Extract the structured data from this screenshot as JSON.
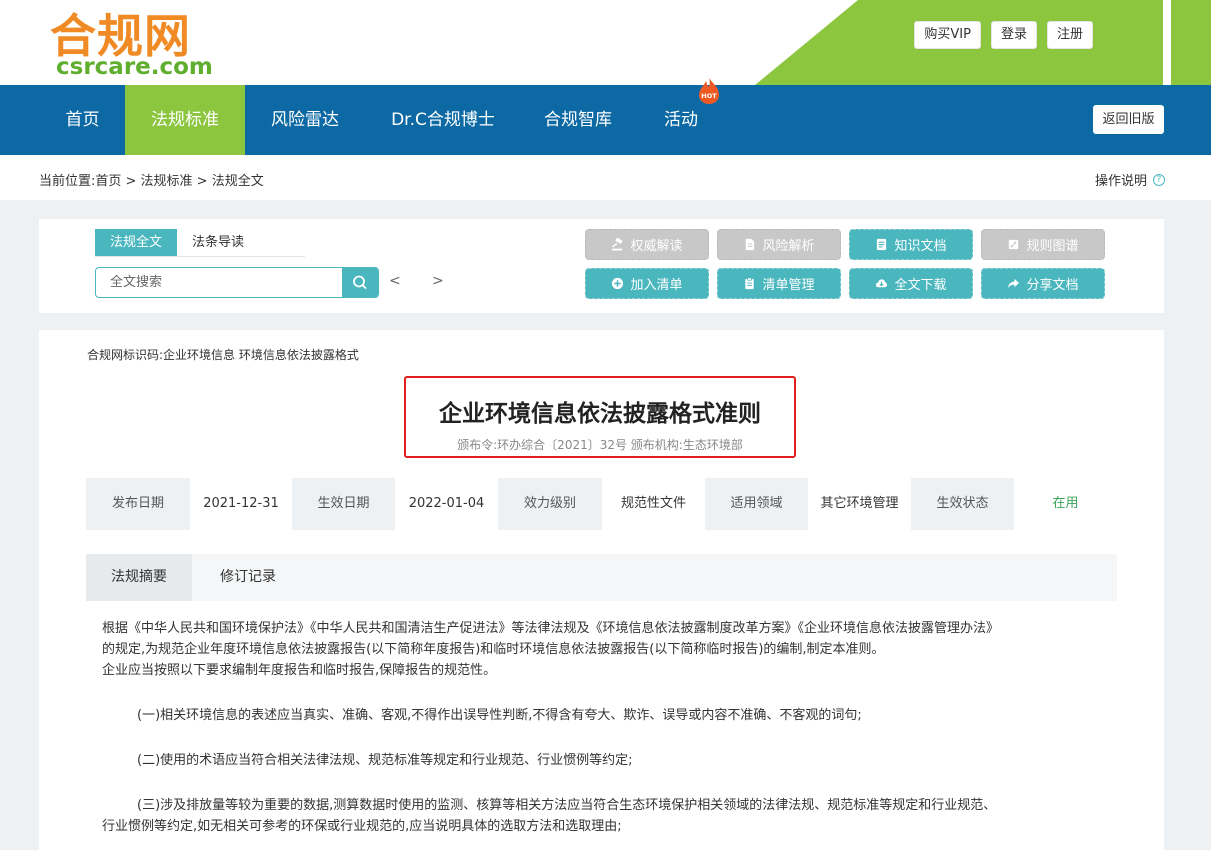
{
  "logo": {
    "cn": "合规网",
    "en": "csrcare.com"
  },
  "user_actions": [
    "购买VIP",
    "登录",
    "注册"
  ],
  "nav": {
    "items": [
      "首页",
      "法规标准",
      "风险雷达",
      "Dr.C合规博士",
      "合规智库",
      "活动"
    ],
    "hot_label": "HOT",
    "old_version": "返回旧版"
  },
  "breadcrumb": {
    "prefix": "当前位置:",
    "path": "首页 > 法规标准 > 法规全文"
  },
  "help_label": "操作说明",
  "tool_panel": {
    "tabs": [
      "法规全文",
      "法条导读"
    ],
    "search_placeholder": "全文搜索",
    "prev": "<",
    "next": ">",
    "actions": [
      {
        "label": "权威解读",
        "icon": "gavel-icon",
        "enabled": false
      },
      {
        "label": "风险解析",
        "icon": "document-icon",
        "enabled": false
      },
      {
        "label": "知识文档",
        "icon": "docs-icon",
        "enabled": true
      },
      {
        "label": "规则图谱",
        "icon": "graph-icon",
        "enabled": false
      },
      {
        "label": "加入清单",
        "icon": "plus-circle-icon",
        "enabled": true
      },
      {
        "label": "清单管理",
        "icon": "clipboard-icon",
        "enabled": true
      },
      {
        "label": "全文下载",
        "icon": "cloud-download-icon",
        "enabled": true
      },
      {
        "label": "分享文档",
        "icon": "share-icon",
        "enabled": true
      }
    ]
  },
  "document": {
    "identifier": "合规网标识码:企业环境信息 环境信息依法披露格式",
    "title": "企业环境信息依法披露格式准则",
    "subtitle": "颁布令:环办综合〔2021〕32号 颁布机构:生态环境部",
    "meta": [
      {
        "label": "发布日期",
        "value": "2021-12-31"
      },
      {
        "label": "生效日期",
        "value": "2022-01-04"
      },
      {
        "label": "效力级别",
        "value": "规范性文件"
      },
      {
        "label": "适用领域",
        "value": "其它环境管理"
      },
      {
        "label": "生效状态",
        "value": "在用"
      }
    ],
    "summary_tabs": [
      "法规摘要",
      "修订记录"
    ],
    "paragraphs": [
      "根据《中华人民共和国环境保护法》《中华人民共和国清洁生产促进法》等法律法规及《环境信息依法披露制度改革方案》《企业环境信息依法披露管理办法》",
      "的规定,为规范企业年度环境信息依法披露报告(以下简称年度报告)和临时环境信息依法披露报告(以下简称临时报告)的编制,制定本准则。",
      "企业应当按照以下要求编制年度报告和临时报告,保障报告的规范性。",
      "(一)相关环境信息的表述应当真实、准确、客观,不得作出误导性判断,不得含有夸大、欺诈、误导或内容不准确、不客观的词句;",
      "(二)使用的术语应当符合相关法律法规、规范标准等规定和行业规范、行业惯例等约定;",
      "(三)涉及排放量等较为重要的数据,测算数据时使用的监测、核算等相关方法应当符合生态环境保护相关领域的法律法规、规范标准等规定和行业规范、",
      "行业惯例等约定,如无相关可参考的环保或行业规范的,应当说明具体的选取方法和选取理由;"
    ]
  },
  "colors": {
    "nav_blue": "#0d69a3",
    "nav_active_green": "#8cc63f",
    "teal": "#4ab6be",
    "highlight_red": "#e02020",
    "status_green": "#3ba35a"
  }
}
